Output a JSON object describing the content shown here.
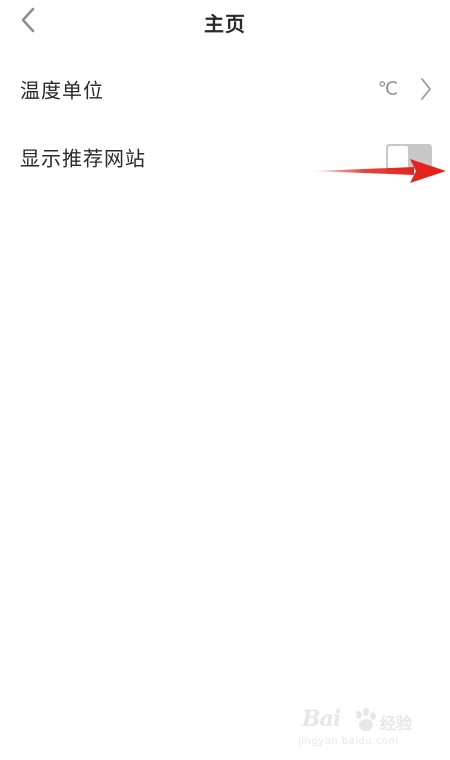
{
  "header": {
    "title": "主页"
  },
  "settings": [
    {
      "label": "温度单位",
      "value": "℃",
      "control": "disclosure"
    },
    {
      "label": "显示推荐网站",
      "control": "toggle",
      "enabled": false
    }
  ],
  "colors": {
    "text": "#2a2a2a",
    "secondary_text": "#8e8e93",
    "toggle_off": "#c8c8c8",
    "annotation_arrow": "#e3241c"
  },
  "icons": {
    "back": "chevron-left-icon",
    "disclosure": "chevron-right-icon"
  },
  "watermark": {
    "brand": "Bai",
    "suffix": "经验",
    "url": "jingyan.baidu.com"
  }
}
